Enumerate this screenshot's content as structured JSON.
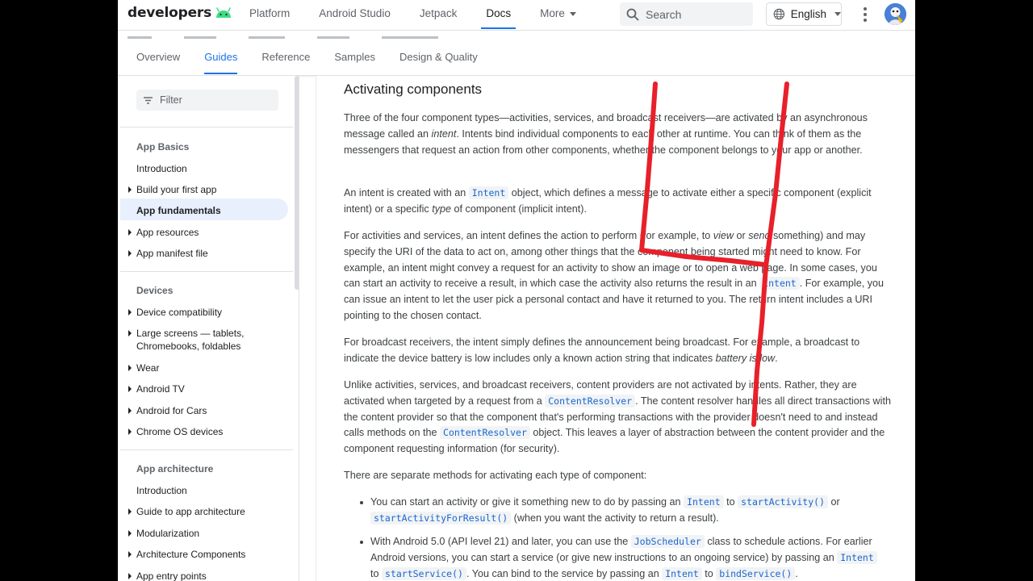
{
  "header": {
    "logo_text": "developers",
    "nav": [
      {
        "label": "Platform"
      },
      {
        "label": "Android Studio"
      },
      {
        "label": "Jetpack"
      },
      {
        "label": "Docs"
      },
      {
        "label": "More"
      }
    ],
    "search_placeholder": "Search",
    "language": "English"
  },
  "subnav": {
    "tabs": [
      {
        "label": "Overview"
      },
      {
        "label": "Guides"
      },
      {
        "label": "Reference"
      },
      {
        "label": "Samples"
      },
      {
        "label": "Design & Quality"
      }
    ]
  },
  "sidebar": {
    "filter_placeholder": "Filter",
    "sections": [
      {
        "title": "App Basics",
        "items": [
          {
            "label": "Introduction"
          },
          {
            "label": "Build your first app"
          },
          {
            "label": "App fundamentals"
          },
          {
            "label": "App resources"
          },
          {
            "label": "App manifest file"
          }
        ]
      },
      {
        "title": "Devices",
        "items": [
          {
            "label": "Device compatibility"
          },
          {
            "label": "Large screens — tablets,"
          },
          {
            "label": "Chromebooks, foldables"
          },
          {
            "label": "Wear"
          },
          {
            "label": "Android TV"
          },
          {
            "label": "Android for Cars"
          },
          {
            "label": "Chrome OS devices"
          }
        ]
      },
      {
        "title": "App architecture",
        "items": [
          {
            "label": "Introduction"
          },
          {
            "label": "Guide to app architecture"
          },
          {
            "label": "Modularization"
          },
          {
            "label": "Architecture Components"
          },
          {
            "label": "App entry points"
          }
        ]
      }
    ]
  },
  "article": {
    "heading": "Activating components",
    "p1": {
      "a": "Three of the four component types—activities, services, and broadcast receivers—are activated by an asynchronous message called an ",
      "em": "intent",
      "b": ". Intents bind individual components to each other at runtime. You can think of them as the messengers that request an action from other components, whether the component belongs to your app or another."
    },
    "p2": {
      "a": "An intent is created with an ",
      "code": "Intent",
      "b": " object, which defines a message to activate either a specific component (explicit intent) or a specific ",
      "em": "type",
      "c": " of component (implicit intent)."
    },
    "p3": {
      "a": "For activities and services, an intent defines the action to perform (for example, to ",
      "em1": "view",
      "b": " or ",
      "em2": "send",
      "c": " something) and may specify the URI of the data to act on, among other things that the component being started might need to know. For example, an intent might convey a request for an activity to show an image or to open a web page. In some cases, you can start an activity to receive a result, in which case the activity also returns the result in an ",
      "code": "Intent",
      "d": ". For example, you can issue an intent to let the user pick a personal contact and have it returned to you. The return intent includes a URI pointing to the chosen contact."
    },
    "p4": {
      "a": "For broadcast receivers, the intent simply defines the announcement being broadcast. For example, a broadcast to indicate the device battery is low includes only a known action string that indicates ",
      "em": "battery is low",
      "b": "."
    },
    "p5": {
      "a": "Unlike activities, services, and broadcast receivers, content providers are not activated by intents. Rather, they are activated when targeted by a request from a ",
      "code1": "ContentResolver",
      "b": ". The content resolver handles all direct transactions with the content provider so that the component that's performing transactions with the provider doesn't need to and instead calls methods on the ",
      "code2": "ContentResolver",
      "c": " object. This leaves a layer of abstraction between the content provider and the component requesting information (for security)."
    },
    "p6": "There are separate methods for activating each type of component:",
    "li1": {
      "a": "You can start an activity or give it something new to do by passing an ",
      "code1": "Intent",
      "b": " to ",
      "code2": "startActivity()",
      "c": " or ",
      "code3": "startActivityForResult()",
      "d": " (when you want the activity to return a result)."
    },
    "li2": {
      "a": "With Android 5.0 (API level 21) and later, you can use the ",
      "code1": "JobScheduler",
      "b": " class to schedule actions. For earlier Android versions, you can start a service (or give new instructions to an ongoing service) by passing an ",
      "code2": "Intent",
      "c": " to ",
      "code3": "startService()",
      "d": ". You can bind to the service by passing an ",
      "code4": "Intent",
      "e": " to ",
      "code5": "bindService()",
      "f": "."
    }
  },
  "colors": {
    "accent": "#1a73e8",
    "android_green": "#3ddc84",
    "annotation_red": "#e8202a"
  }
}
